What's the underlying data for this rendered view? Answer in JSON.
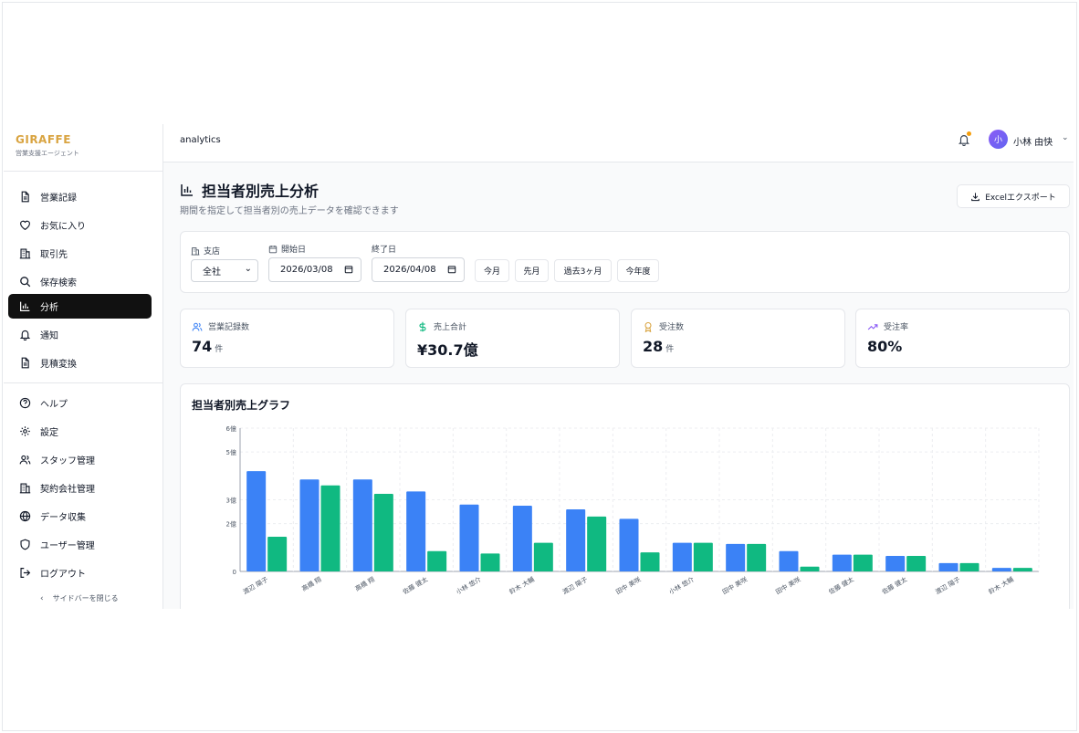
{
  "brand": {
    "name": "GIRAFFE",
    "subtitle": "営業支援エージェント"
  },
  "sidebar": {
    "items": [
      {
        "label": "営業記録",
        "icon": "document-icon"
      },
      {
        "label": "お気に入り",
        "icon": "heart-icon"
      },
      {
        "label": "取引先",
        "icon": "building-icon"
      },
      {
        "label": "保存検索",
        "icon": "search-icon"
      },
      {
        "label": "分析",
        "icon": "bar-chart-icon",
        "active": true
      },
      {
        "label": "通知",
        "icon": "bell-icon"
      },
      {
        "label": "見積変換",
        "icon": "document-icon"
      }
    ],
    "secondary_items": [
      {
        "label": "ヘルプ",
        "icon": "help-icon"
      },
      {
        "label": "設定",
        "icon": "gear-icon"
      },
      {
        "label": "スタッフ管理",
        "icon": "users-icon"
      },
      {
        "label": "契約会社管理",
        "icon": "building-icon"
      },
      {
        "label": "データ収集",
        "icon": "globe-icon"
      },
      {
        "label": "ユーザー管理",
        "icon": "shield-icon"
      },
      {
        "label": "ログアウト",
        "icon": "logout-icon"
      }
    ],
    "collapse_label": "サイドバーを閉じる"
  },
  "header": {
    "page_key": "analytics",
    "user": {
      "avatar_initial": "小",
      "name": "小林 由快"
    }
  },
  "page": {
    "title": "担当者別売上分析",
    "subtitle": "期間を指定して担当者別の売上データを確認できます",
    "export_label": "Excelエクスポート"
  },
  "filters": {
    "branch_label": "支店",
    "branch_value": "全社",
    "start_label": "開始日",
    "start_value": "2026/03/08",
    "end_label": "終了日",
    "end_value": "2026/04/08",
    "quick": [
      "今月",
      "先月",
      "過去3ヶ月",
      "今年度"
    ]
  },
  "stats": [
    {
      "label": "営業記録数",
      "value": "74",
      "unit": "件",
      "icon": "users-icon",
      "color": "#3b82f6"
    },
    {
      "label": "売上合計",
      "value": "¥30.7億",
      "unit": "",
      "icon": "dollar-icon",
      "color": "#10b981"
    },
    {
      "label": "受注数",
      "value": "28",
      "unit": "件",
      "icon": "award-icon",
      "color": "#d9a441"
    },
    {
      "label": "受注率",
      "value": "80%",
      "unit": "",
      "icon": "trending-up-icon",
      "color": "#8b5cf6"
    }
  ],
  "chart_title": "担当者別売上グラフ",
  "colors": {
    "blue": "#3b82f6",
    "green": "#10b981",
    "active_bg": "#111111",
    "brand": "#d9a441"
  },
  "chart_data": {
    "type": "bar",
    "title": "担当者別売上グラフ",
    "categories": [
      "渡辺 陽子",
      "高橋 翔",
      "高橋 翔",
      "佐藤 健太",
      "小林 悠介",
      "鈴木 大輔",
      "渡辺 陽子",
      "田中 美咲",
      "小林 悠介",
      "田中 美咲",
      "田中 美咲",
      "佐藤 健太",
      "佐藤 健太",
      "渡辺 陽子",
      "鈴木 大輔"
    ],
    "series": [
      {
        "color": "#3b82f6",
        "values": [
          4.2,
          3.85,
          3.85,
          3.35,
          2.8,
          2.75,
          2.6,
          2.2,
          1.2,
          1.15,
          0.85,
          0.7,
          0.65,
          0.35,
          0.15
        ]
      },
      {
        "color": "#10b981",
        "values": [
          1.45,
          3.6,
          3.25,
          0.85,
          0.75,
          1.2,
          2.3,
          0.8,
          1.2,
          1.15,
          0.2,
          0.7,
          0.65,
          0.35,
          0.15
        ]
      }
    ],
    "yticks": [
      "0",
      "2億",
      "3億",
      "5億",
      "6億"
    ],
    "ylim": [
      0,
      6
    ],
    "grid": true,
    "legend": "none"
  }
}
